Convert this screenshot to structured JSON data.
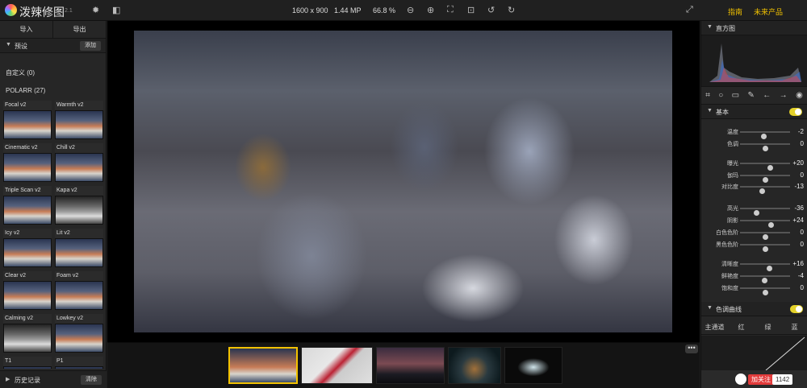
{
  "app": {
    "name": "泼辣修图",
    "version": "2.1"
  },
  "toolbar": {
    "dimensions": "1600 x 900",
    "megapixels": "1.44 MP",
    "zoom": "66.8 %",
    "guide": "指南",
    "future": "未来产品"
  },
  "left": {
    "tab_import": "导入",
    "tab_export": "导出",
    "presets_label": "预设",
    "add_label": "添加",
    "custom": "自定义 (0)",
    "polarr": "POLARR (27)",
    "filters": [
      "Focal v2",
      "Warmth v2",
      "Cinematic v2",
      "Chill v2",
      "Triple Scan v2",
      "Kapa v2",
      "Icy v2",
      "Lit v2",
      "Clear v2",
      "Foam v2",
      "Calming v2",
      "Lowkey v2",
      "T1",
      "P1"
    ],
    "history_label": "历史记录",
    "clear_label": "清除"
  },
  "right": {
    "histogram": "直方图",
    "basic": "基本",
    "curves": "色调曲线",
    "sliders": [
      {
        "label": "温度",
        "value": "-2",
        "pos": 0.47
      },
      {
        "label": "色调",
        "value": "0",
        "pos": 0.5
      },
      {
        "label": "曝光",
        "value": "+20",
        "pos": 0.6
      },
      {
        "label": "伽玛",
        "value": "0",
        "pos": 0.5
      },
      {
        "label": "对比度",
        "value": "-13",
        "pos": 0.43
      },
      {
        "label": "高光",
        "value": "-36",
        "pos": 0.32
      },
      {
        "label": "阴影",
        "value": "+24",
        "pos": 0.62
      },
      {
        "label": "白色色阶",
        "value": "0",
        "pos": 0.5
      },
      {
        "label": "黑色色阶",
        "value": "0",
        "pos": 0.5
      },
      {
        "label": "清晰度",
        "value": "+16",
        "pos": 0.58
      },
      {
        "label": "鲜艳度",
        "value": "-4",
        "pos": 0.48
      },
      {
        "label": "饱和度",
        "value": "0",
        "pos": 0.5
      }
    ],
    "channels": [
      "主通道",
      "红",
      "绿",
      "蓝"
    ],
    "follow": "加关注",
    "follow_count": "1142"
  }
}
